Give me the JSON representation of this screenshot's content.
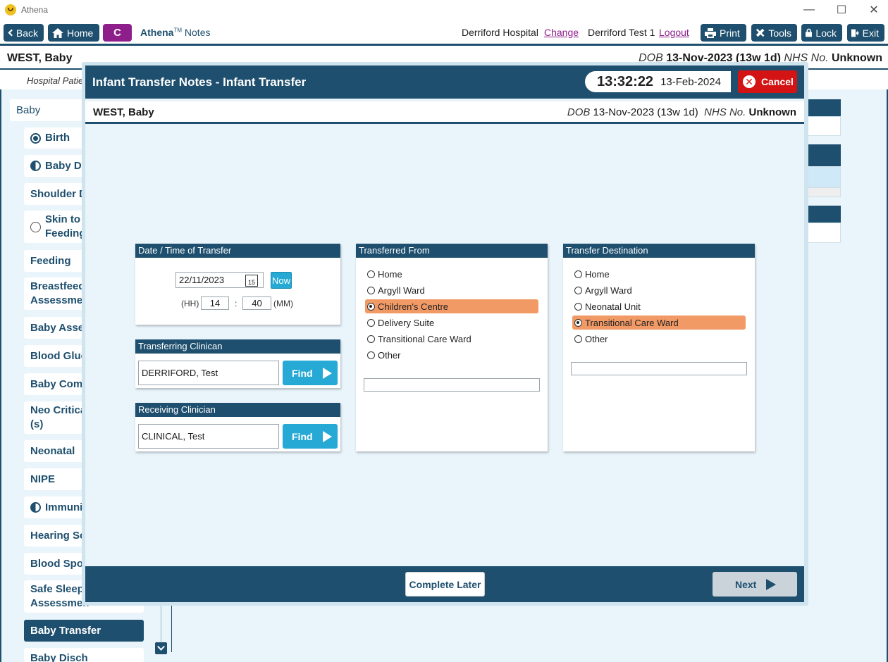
{
  "window": {
    "title": "Athena",
    "minimize": "—",
    "maximize": "☐",
    "close": "✕"
  },
  "toolbar": {
    "back": "Back",
    "home": "Home",
    "c": "C",
    "brand_bold": "Athena",
    "brand_tm": "TM",
    "brand_rest": " Notes",
    "hospital": "Derriford Hospital",
    "change": "Change",
    "user": "Derriford Test 1",
    "logout": "Logout",
    "print": "Print",
    "tools": "Tools",
    "lock": "Lock",
    "exit": "Exit"
  },
  "patient": {
    "name": "WEST, Baby",
    "dob_label": "DOB",
    "dob": "13-Nov-2023 (13w 1d)",
    "nhs_label": "NHS No.",
    "nhs": "Unknown",
    "sub": "Hospital Patie"
  },
  "sidebar": {
    "head": "Baby",
    "items": [
      "Birth",
      "Baby Dev",
      "Shoulder D",
      "Skin to S",
      "Feeding",
      "Feeding",
      "Breastfeedi",
      "Assessmen",
      "Baby Asses",
      "Blood Gluc",
      "Baby Comm",
      "Neo Critica",
      "(s)",
      "Neonatal",
      "NIPE",
      "Immunis",
      "Hearing Sc",
      "Blood Spot",
      "Safe Sleepi",
      "Assessmen",
      "Baby Transfer",
      "Baby Disch"
    ]
  },
  "modal": {
    "title": "Infant Transfer Notes - Infant Transfer",
    "time": "13:32:22",
    "date": "13-Feb-2024",
    "cancel": "Cancel"
  },
  "datetime": {
    "header": "Date / Time of Transfer",
    "date_value": "22/11/2023",
    "cal_day": "15",
    "now": "Now",
    "hh_label": "(HH)",
    "hh": "14",
    "sep": ":",
    "mm": "40",
    "mm_label": "(MM)"
  },
  "transferring": {
    "header": "Transferring Clinican",
    "value": "DERRIFORD, Test",
    "find": "Find"
  },
  "receiving": {
    "header": "Receiving Clinician",
    "value": "CLINICAL, Test",
    "find": "Find"
  },
  "from": {
    "header": "Transferred From",
    "options": [
      "Home",
      "Argyll Ward",
      "Children's Centre",
      "Delivery Suite",
      "Transitional Care Ward",
      "Other"
    ],
    "selected": "Children's Centre",
    "other_value": ""
  },
  "dest": {
    "header": "Transfer Destination",
    "options": [
      "Home",
      "Argyll Ward",
      "Neonatal Unit",
      "Transitional Care Ward",
      "Other"
    ],
    "selected": "Transitional Care Ward",
    "other_value": ""
  },
  "footer": {
    "later": "Complete Later",
    "next": "Next"
  },
  "colors": {
    "navy": "#1e4f6e",
    "accent": "#26a9d4",
    "selected": "#f29a66",
    "cancel": "#d41414",
    "module": "#8e1e8a"
  }
}
